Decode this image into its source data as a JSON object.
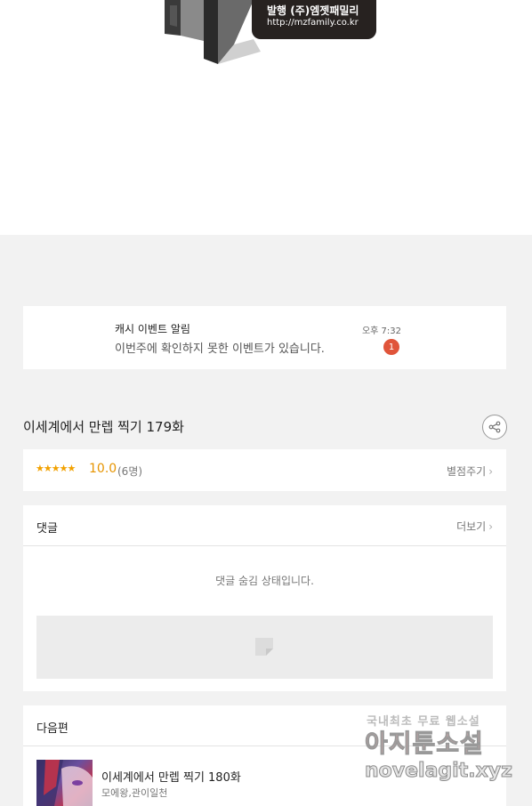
{
  "publisher_logo": {
    "line1": "발행 (주)엠젯패밀리",
    "line2": "http://mzfamily.co.kr"
  },
  "notification": {
    "title": "캐시 이벤트 알림",
    "message": "이번주에 확인하지 못한 이벤트가 있습니다.",
    "time": "오후 7:32",
    "badge_count": "1",
    "badge_color": "#e0543a"
  },
  "episode": {
    "title": "이세계에서 만렙 찍기 179화",
    "share_icon": "share-icon"
  },
  "rating": {
    "stars": "★★★★★",
    "score": "10.0",
    "count": "(6명)",
    "rate_label": "별점주기",
    "star_color": "#f2a100"
  },
  "comments": {
    "title": "댓글",
    "more_label": "더보기",
    "hidden_message": "댓글 숨김 상태입니다."
  },
  "next_episode": {
    "section_title": "다음편",
    "title": "이세계에서 만렙 찍기 180화",
    "author": "모에왕,관이일천"
  },
  "watermark": {
    "line1": "국내최초 무료 웹소설",
    "line2": "아지툰소설",
    "line3": "novelagit.xyz"
  }
}
